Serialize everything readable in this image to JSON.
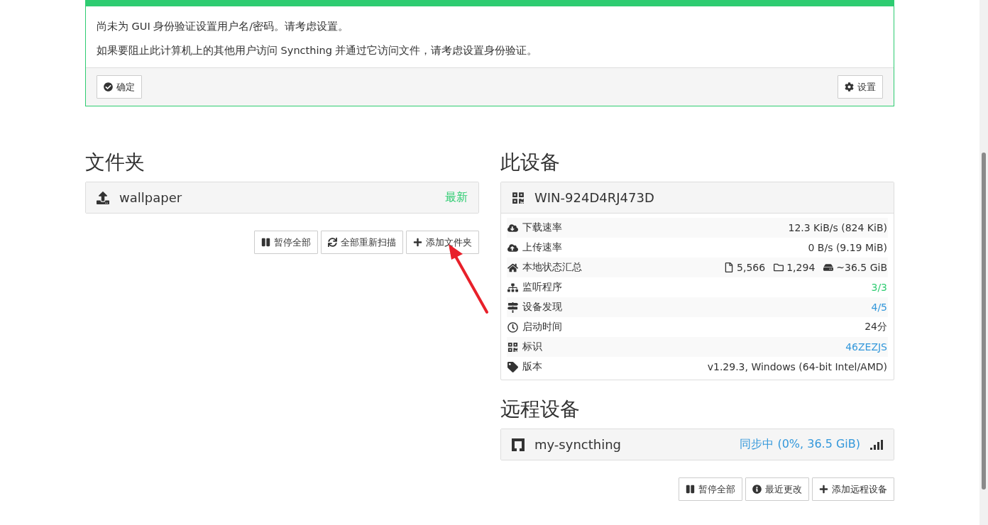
{
  "alert": {
    "lines": [
      "尚未为 GUI 身份验证设置用户名/密码。请考虑设置。",
      "如果要阻止此计算机上的其他用户访问 Syncthing 并通过它访问文件，请考虑设置身份验证。"
    ],
    "ok_button": "确定",
    "settings_button": "设置"
  },
  "folders": {
    "title": "文件夹",
    "items": [
      {
        "name": "wallpaper",
        "status": "最新",
        "color": "#2ecc71"
      }
    ],
    "buttons": [
      {
        "kind": "pause",
        "label": "暂停全部"
      },
      {
        "kind": "rescan",
        "label": "全部重新扫描"
      },
      {
        "kind": "add",
        "label": "添加文件夹"
      }
    ]
  },
  "this_device": {
    "title": "此设备",
    "name": "WIN-924D4RJ473D",
    "rows": [
      {
        "kind": "download",
        "label": "下载速率",
        "value": "12.3 KiB/s (824 KiB)",
        "color": "#333333"
      },
      {
        "kind": "upload",
        "label": "上传速率",
        "value": "0 B/s (9.19 MiB)",
        "color": "#333333"
      },
      {
        "kind": "summary",
        "label": "本地状态汇总",
        "files": "5,566",
        "dirs": "1,294",
        "size": "~36.5 GiB",
        "color": "#333333"
      },
      {
        "kind": "listeners",
        "label": "监听程序",
        "value": "3/3",
        "color": "#2ecc71"
      },
      {
        "kind": "discovery",
        "label": "设备发现",
        "value": "4/5",
        "color": "#3498db"
      },
      {
        "kind": "uptime",
        "label": "启动时间",
        "value": "24分",
        "color": "#333333"
      },
      {
        "kind": "id",
        "label": "标识",
        "value": "46ZEZJS",
        "color": "#3498db"
      },
      {
        "kind": "version",
        "label": "版本",
        "value": "v1.29.3, Windows (64-bit Intel/AMD)",
        "color": "#333333"
      }
    ]
  },
  "remote_devices": {
    "title": "远程设备",
    "items": [
      {
        "name": "my-syncthing",
        "status": "同步中 (0%, 36.5 GiB)",
        "color": "#3498db"
      }
    ],
    "buttons": [
      {
        "kind": "pause",
        "label": "暂停全部"
      },
      {
        "kind": "info",
        "label": "最近更改"
      },
      {
        "kind": "add",
        "label": "添加远程设备"
      }
    ]
  }
}
